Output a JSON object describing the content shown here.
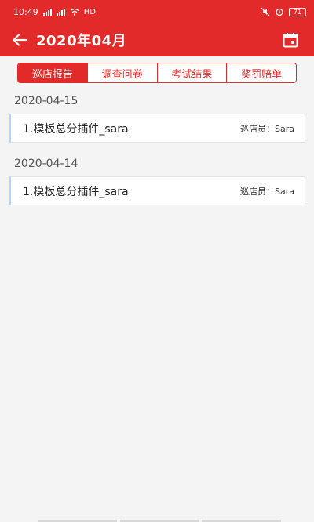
{
  "status_bar": {
    "time": "10:49",
    "network": "HD",
    "battery": "71"
  },
  "header": {
    "title": "2020年04月"
  },
  "tabs": [
    {
      "label": "巡店报告",
      "active": true
    },
    {
      "label": "调查问卷",
      "active": false
    },
    {
      "label": "考试结果",
      "active": false
    },
    {
      "label": "奖罚赔单",
      "active": false
    }
  ],
  "groups": [
    {
      "date": "2020-04-15",
      "items": [
        {
          "title": "1.模板总分插件_sara",
          "meta_label": "巡店员：",
          "meta_value": "Sara"
        }
      ]
    },
    {
      "date": "2020-04-14",
      "items": [
        {
          "title": "1.模板总分插件_sara",
          "meta_label": "巡店员：",
          "meta_value": "Sara"
        }
      ]
    }
  ],
  "colors": {
    "accent": "#e32a2a",
    "record_border": "#b9d3f0",
    "background": "#f4f4f4"
  }
}
